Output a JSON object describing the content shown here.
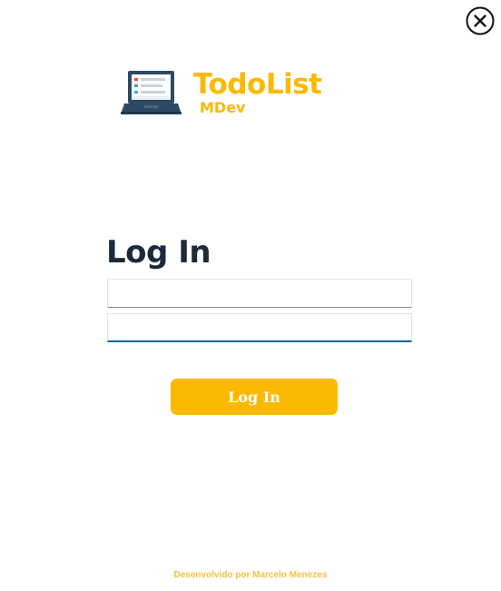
{
  "window": {
    "close_icon": "close-circle-icon"
  },
  "logo": {
    "icon": "laptop-list-icon",
    "title": "TodoList",
    "subtitle": "MDev"
  },
  "form": {
    "title": "Log In",
    "username": {
      "value": "",
      "placeholder": ""
    },
    "password": {
      "value": "",
      "placeholder": ""
    },
    "submit_label": "Log In"
  },
  "footer": {
    "credit": "Desenvolvido por Marcelo Menezes"
  },
  "colors": {
    "accent": "#fbb901",
    "title_text": "#1d2a3a",
    "focus_underline": "#0f63a8"
  }
}
